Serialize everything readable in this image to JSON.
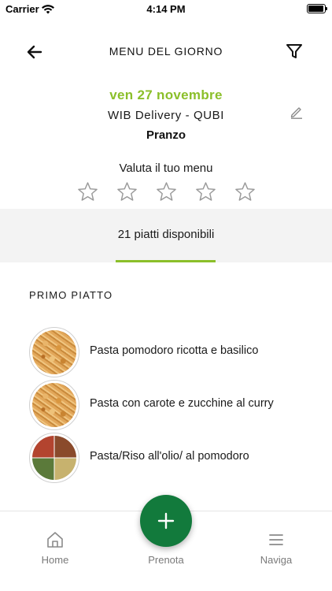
{
  "status_bar": {
    "carrier": "Carrier",
    "time": "4:14 PM",
    "battery_level": 0.95
  },
  "header": {
    "title": "MENU DEL GIORNO",
    "back_icon": "arrow-left-icon",
    "filter_icon": "filter-icon"
  },
  "info": {
    "date": "ven 27 novembre",
    "location": "WIB Delivery - QUBI",
    "meal": "Pranzo",
    "edit_icon": "pencil-icon"
  },
  "rating": {
    "label": "Valuta il tuo menu",
    "stars_total": 5,
    "stars_filled": 0
  },
  "availability": {
    "count_text": "21 piatti disponibili"
  },
  "section": {
    "title": "PRIMO PIATTO",
    "dishes": [
      {
        "name": "Pasta pomodoro ricotta e basilico"
      },
      {
        "name": "Pasta con carote e zucchine al curry"
      },
      {
        "name": "Pasta/Riso all'olio/ al pomodoro"
      }
    ]
  },
  "bottom_nav": {
    "home_label": "Home",
    "book_label": "Prenota",
    "navigate_label": "Naviga",
    "fab_icon": "plus-icon"
  },
  "colors": {
    "accent_green": "#8bbf2a",
    "fab_green": "#127a3c",
    "band_gray": "#f3f3f3"
  }
}
